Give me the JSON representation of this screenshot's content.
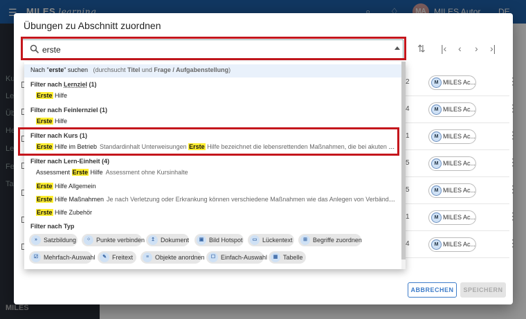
{
  "app": {
    "brand": "MILES",
    "brand_sub": "learning",
    "user_initials": "MA",
    "user_name": "MILES Autor",
    "language": "DE"
  },
  "sidenav": {
    "items": [
      "Ku",
      "Le",
      "Üb",
      "He",
      "Le",
      "Fe",
      "Ta"
    ],
    "footer": "MILES"
  },
  "dialog": {
    "title": "Übungen zu Abschnitt zuordnen",
    "cancel_label": "ABBRECHEN",
    "save_label": "SPEICHERN"
  },
  "search": {
    "value": "erste"
  },
  "dropdown": {
    "search_all": {
      "prefix": "Nach \"",
      "term": "erste",
      "suffix": "\" suchen",
      "hint_a": "(durchsucht ",
      "hint_b": "Titel",
      "hint_c": " und ",
      "hint_d": "Frage / Aufgabenstellung",
      "hint_e": ")"
    },
    "group_lernziel": {
      "label": "Filter nach ",
      "bold": "Lernziel",
      "count": " (1)"
    },
    "opt_lernziel": {
      "mark": "Erste",
      "rest": " Hilfe"
    },
    "group_feinlernziel": {
      "label": "Filter nach ",
      "bold": "Feinlernziel",
      "count": " (1)"
    },
    "opt_feinlernziel": {
      "mark": "Erste",
      "rest": " Hilfe"
    },
    "group_kurs": {
      "label": "Filter nach ",
      "bold": "Kurs",
      "count": " (1)"
    },
    "opt_kurs": {
      "mark": "Erste",
      "rest": " Hilfe im Betrieb",
      "desc_a": "Standardinhalt Unterweisungen ",
      "desc_mark": "Erste",
      "desc_b": " Hilfe bezeichnet die lebensrettenden Maßnahmen, die bei akuten Verletzungen oder Erkrankungen"
    },
    "group_lerneinheit": {
      "label": "Filter nach ",
      "bold": "Lern-Einheit",
      "count": " (4)"
    },
    "opt_le1": {
      "a": "Assessment ",
      "mark": "Erste",
      "b": " Hilfe",
      "desc": "Assessment ohne Kursinhalte"
    },
    "opt_le2": {
      "mark": "Erste",
      "rest": " Hilfe Allgemein"
    },
    "opt_le3": {
      "mark": "Erste",
      "rest": " Hilfe Maßnahmen",
      "desc": "Je nach Verletzung oder Erkrankung können verschiedene Maßnahmen wie das Anlegen von Verbänden, das Stabilisieren"
    },
    "opt_le4": {
      "mark": "Erste",
      "rest": " Hilfe Zubehör"
    },
    "group_typ": {
      "label": "Filter nach ",
      "bold": "Typ"
    },
    "types": [
      "Satzbildung",
      "Punkte verbinden",
      "Dokument",
      "Bild Hotspot",
      "Lückentext",
      "Begriffe zuordnen",
      "Mehrfach-Auswahl",
      "Freitext",
      "Objekte anordnen",
      "Einfach-Auswahl",
      "Tabelle"
    ]
  },
  "table": {
    "rows": [
      {
        "num": "2",
        "author": "MILES Ac..."
      },
      {
        "num": "4",
        "author": "MILES Ac..."
      },
      {
        "num": "1",
        "author": "MILES Ac..."
      },
      {
        "num": "5",
        "author": "MILES Ac..."
      },
      {
        "num": "5",
        "author": "MILES Ac..."
      },
      {
        "num": "1",
        "author": "MILES Ac..."
      },
      {
        "num": "4",
        "author": "MILES Ac..."
      }
    ],
    "avatar_initials": "M"
  },
  "colors": {
    "highlight_red": "#c4161c",
    "mark_yellow": "#ffee30",
    "primary_blue": "#3d7cc9"
  }
}
